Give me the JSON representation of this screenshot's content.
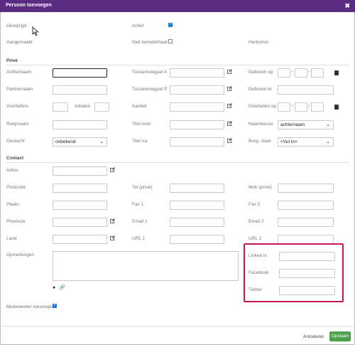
{
  "window": {
    "title": "Persoon toevoegen",
    "close_glyph": "✖"
  },
  "header": {
    "gewijzigd": "Gewijzigd",
    "aangemaakt": "Aangemaakt",
    "actief": "Actief",
    "niet_benaderbaar": "Niet benaderbaar",
    "herkomst": "Herkomst"
  },
  "prive": {
    "section": "Privé",
    "achternaam": "Achternaam",
    "partnernaam": "Partnernaam",
    "voorletters": "Voorletters",
    "initialen": "Initialen",
    "roepnaam": "Roepnaam",
    "geslacht": "Geslacht",
    "geslacht_value": "onbekend",
    "tussenvoegsel_a": "Tussenvoegsel A",
    "tussenvoegsel_p": "Tussenvoegsel P",
    "aanhef": "Aanhef",
    "titel_voor": "Titel voor",
    "titel_na": "Titel na",
    "geboren_op": "Geboren op",
    "geboren_te": "Geboren te",
    "overleden_op": "Overleden op",
    "naamkeuze": "Naamkeuze",
    "naamkeuze_value": "achternaam",
    "burg_staat": "Burg. staat",
    "burg_staat_value": "<Vul in>"
  },
  "contact": {
    "section": "Contact",
    "adres": "Adres",
    "postcode": "Postcode",
    "plaats": "Plaats",
    "provincie": "Provincie",
    "land": "Land",
    "opmerkingen": "Opmerkingen",
    "tel_prive": "Tel (privé)",
    "fax1": "Fax 1",
    "email1": "Email 1",
    "url1": "URL 1",
    "mob_prive": "Mob (privé)",
    "fax2": "Fax 2",
    "email2": "Email 2",
    "url2": "URL 2",
    "linkedin": "Linked in",
    "facebook": "Facebook",
    "twitter": "Twitter",
    "medewerker": "Medewerker toevoegen"
  },
  "footer": {
    "cancel": "Annuleren",
    "save": "Opslaan"
  },
  "colors": {
    "titlebar": "#5b2d82",
    "highlight": "#c2185b",
    "save": "#4aa14a",
    "checkbox": "#1a73e8"
  }
}
